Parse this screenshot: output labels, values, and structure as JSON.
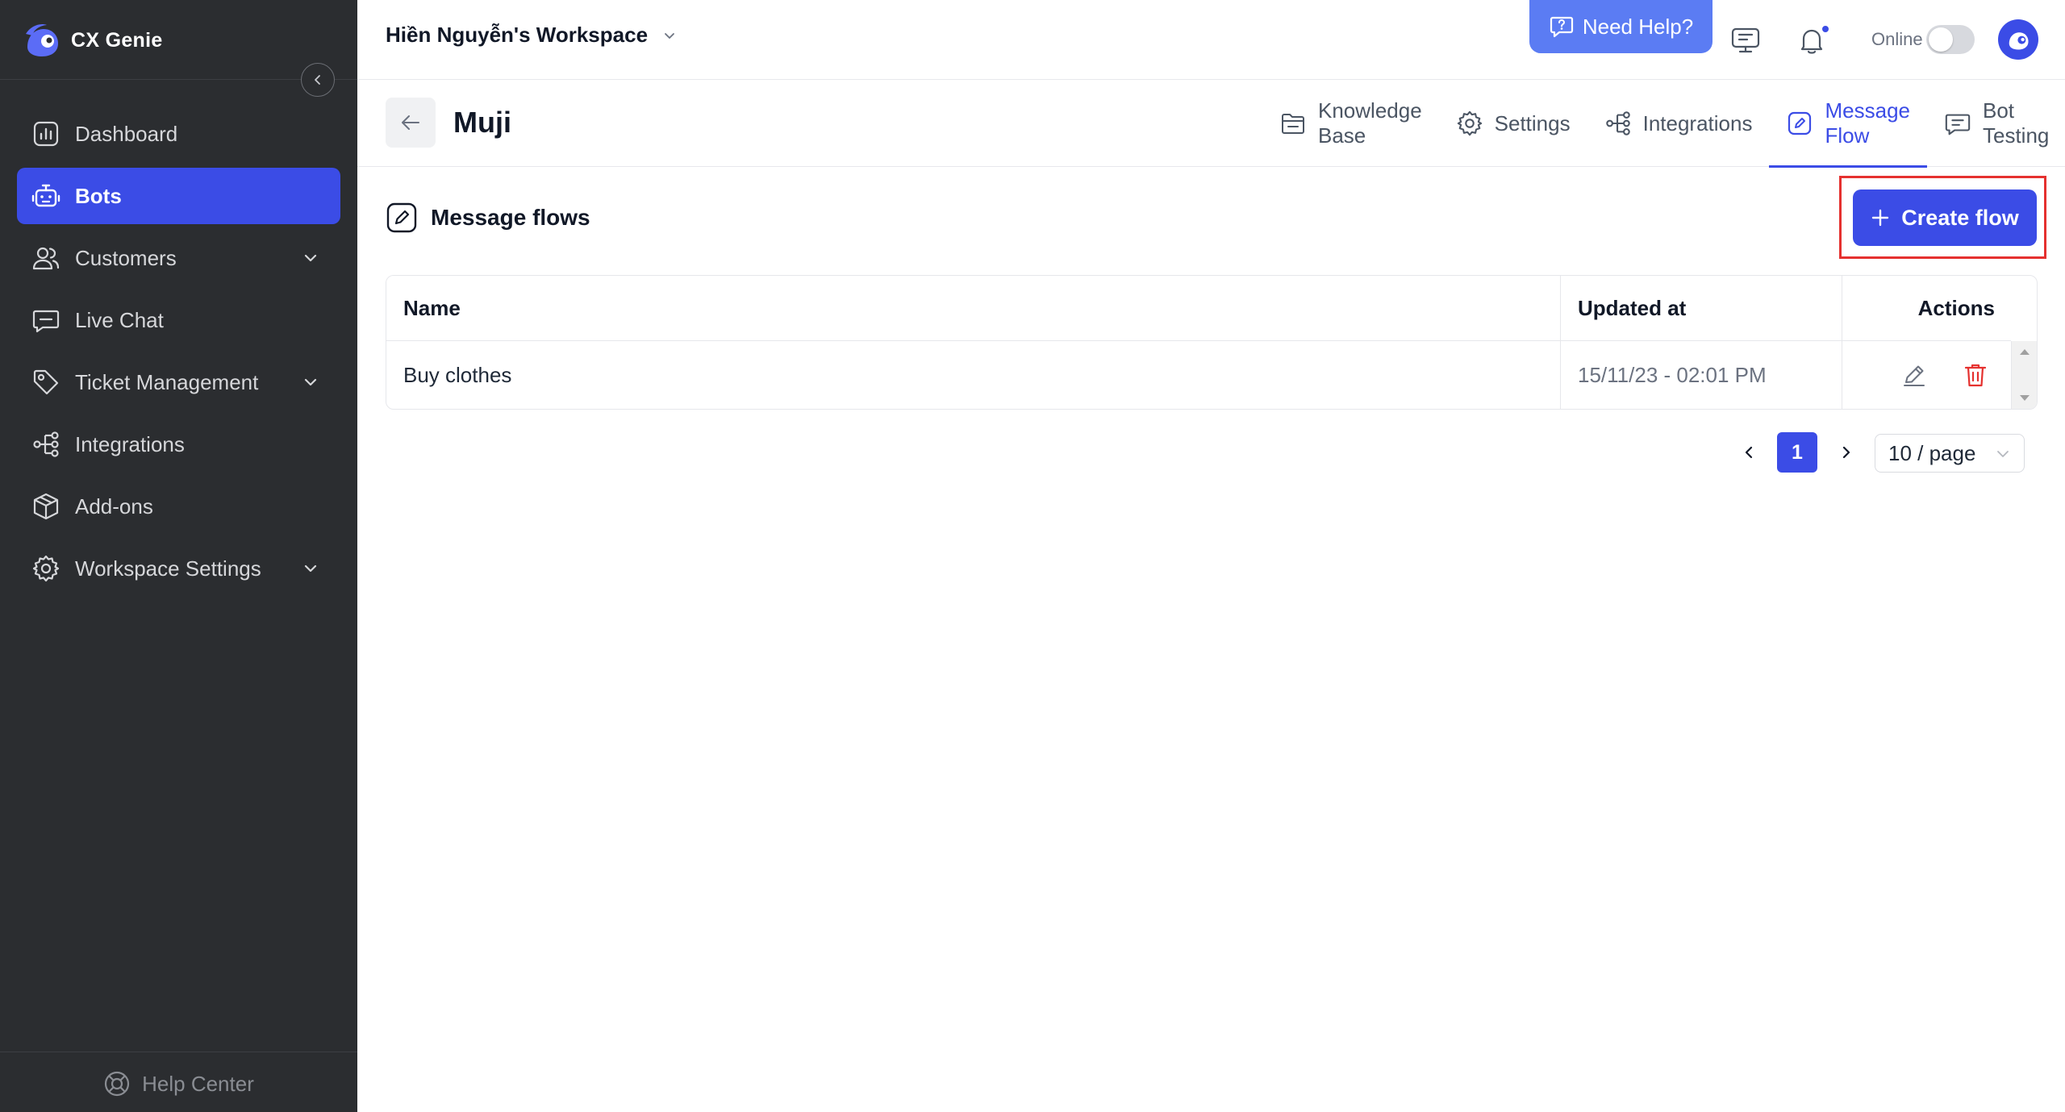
{
  "brand": {
    "name": "CX Genie"
  },
  "sidebar": {
    "items": [
      {
        "label": "Dashboard"
      },
      {
        "label": "Bots"
      },
      {
        "label": "Customers"
      },
      {
        "label": "Live Chat"
      },
      {
        "label": "Ticket Management"
      },
      {
        "label": "Integrations"
      },
      {
        "label": "Add-ons"
      },
      {
        "label": "Workspace Settings"
      }
    ],
    "help_center": "Help Center"
  },
  "topbar": {
    "workspace": "Hiền Nguyễn's Workspace",
    "need_help": "Need Help?",
    "status_label": "Online"
  },
  "bot": {
    "name": "Muji",
    "tabs": [
      {
        "label": "Knowledge Base"
      },
      {
        "label": "Settings"
      },
      {
        "label": "Integrations"
      },
      {
        "label": "Message Flow"
      },
      {
        "label": "Bot Testing"
      }
    ]
  },
  "section": {
    "title": "Message flows",
    "create_label": "Create flow"
  },
  "table": {
    "columns": [
      "Name",
      "Updated at",
      "Actions"
    ],
    "rows": [
      {
        "name": "Buy clothes",
        "updated_at": "15/11/23 - 02:01 PM"
      }
    ]
  },
  "pagination": {
    "current_page": "1",
    "page_size": "10 / page"
  },
  "colors": {
    "accent": "#3b4ce6",
    "sidebar_bg": "#2b2d30",
    "need_help_bg": "#5b7cf3",
    "delete": "#e5312f"
  }
}
